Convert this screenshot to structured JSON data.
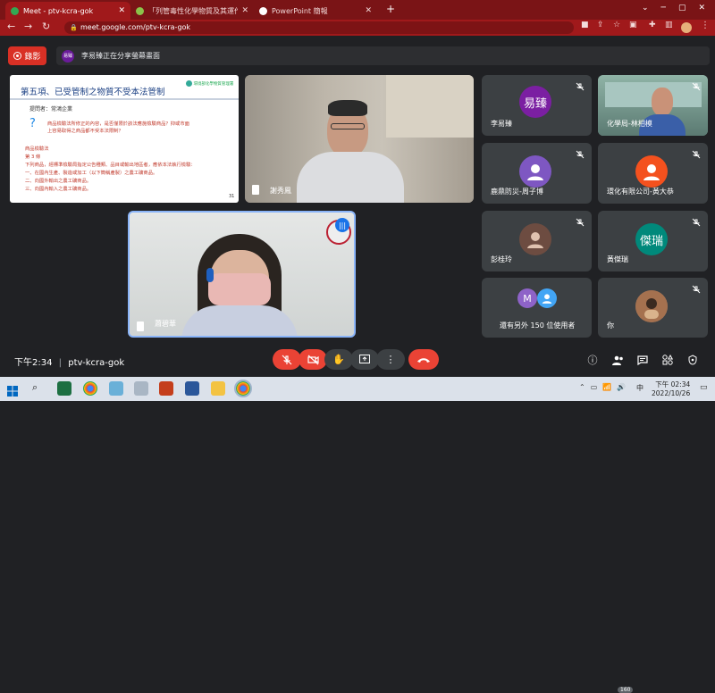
{
  "browser": {
    "tabs": [
      {
        "label": "Meet - ptv-kcra-gok",
        "active": true
      },
      {
        "label": "「列管毒性化學物質及其運作管理」",
        "active": false
      },
      {
        "label": "PowerPoint 簡報",
        "active": false
      }
    ],
    "new_tab": "+",
    "url": "meet.google.com/ptv-kcra-gok"
  },
  "meet": {
    "record_label": "錄影",
    "banner_avatar": "易臻",
    "banner_text": "李易臻正在分享螢幕畫面",
    "slide": {
      "title": "第五項、已受管制之物質不受本法管制",
      "logo_text": "環境部化學物質管理署",
      "presenter": "提問者：常鴻企業",
      "question_1": "商品檢驗法所修正的內容，是否僅限於該法應施檢驗商品？抑或市面",
      "question_2": "上容易取得之商品都不受本法限制？",
      "law": "商品檢驗法",
      "article": "第 3 條",
      "text_1": "下列商品，經標準檢驗局指定公告種類、品目或輸出地區者，應依本法執行檢驗：",
      "text_2": "一、在國內生產、製造或加工（以下簡稱產製）之農工礦商品。",
      "text_3": "二、向國外輸出之農工礦商品。",
      "text_4": "三、向國內輸入之農工礦商品。",
      "page_no": "31"
    },
    "tiles": {
      "main_speaker": "謝秀鳳",
      "presenter_video": "蕭碧華",
      "p1_name": "李易臻",
      "p1_avatar": "易臻",
      "p2_name": "化學局-林相模",
      "p3_name": "鹿鼎防災-周子博",
      "p4_name": "環化有限公司-黃大恭",
      "p5_name": "彭桂玲",
      "p6_name": "黃傑瑞",
      "p6_avatar": "傑瑞",
      "p7_name": "還有另外 150 位使用者",
      "p7_avatar": "M",
      "p8_name": "你"
    },
    "bottom": {
      "time": "下午2:34",
      "separator": "|",
      "meeting_code": "ptv-kcra-gok",
      "people_count": "160"
    }
  },
  "taskbar": {
    "tray_ime": "中",
    "time": "下午 02:34",
    "date": "2022/10/26"
  },
  "colors": {
    "meet_bg": "#202124",
    "tile_bg": "#3c4043",
    "accent_red": "#ea4335",
    "chrome_tab": "#7a1416"
  }
}
